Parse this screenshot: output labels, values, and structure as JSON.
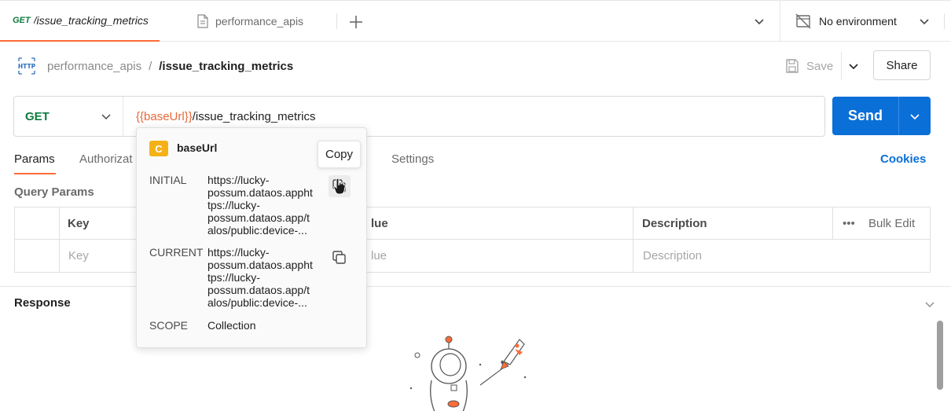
{
  "tabs": {
    "active": {
      "method": "GET",
      "title": "/issue_tracking_metrics"
    },
    "second": {
      "title": "performance_apis"
    }
  },
  "environment": {
    "label": "No environment"
  },
  "breadcrumb": {
    "collection": "performance_apis",
    "separator": "/",
    "request": "/issue_tracking_metrics"
  },
  "toolbar": {
    "save_label": "Save",
    "share_label": "Share"
  },
  "request": {
    "method": "GET",
    "url_variable": "{{baseUrl}}",
    "url_path": "/issue_tracking_metrics",
    "send_label": "Send"
  },
  "subtabs": {
    "params": "Params",
    "authorization": "Authorizat",
    "settings": "Settings",
    "cookies": "Cookies"
  },
  "query_params": {
    "title": "Query Params",
    "headers": {
      "key": "Key",
      "value": "lue",
      "description": "Description",
      "bulk_edit": "Bulk Edit"
    },
    "placeholders": {
      "key": "Key",
      "value": "lue",
      "description": "Description"
    }
  },
  "response": {
    "title": "Response"
  },
  "variable_popup": {
    "badge": "C",
    "name": "baseUrl",
    "initial_label": "INITIAL",
    "initial_value_lines": [
      "https://lucky-",
      "possum.dataos.appht",
      "tps://lucky-",
      "possum.dataos.app/t",
      "alos/public:device-..."
    ],
    "current_label": "CURRENT",
    "current_value_lines": [
      "https://lucky-",
      "possum.dataos.appht",
      "tps://lucky-",
      "possum.dataos.app/t",
      "alos/public:device-..."
    ],
    "scope_label": "SCOPE",
    "scope_value": "Collection",
    "copy_tooltip": "Copy"
  },
  "colors": {
    "accent": "#ff6c37",
    "send": "#0b6fd8",
    "get": "#0f7b3f",
    "variable": "#e8683a",
    "badge": "#f5b118"
  }
}
